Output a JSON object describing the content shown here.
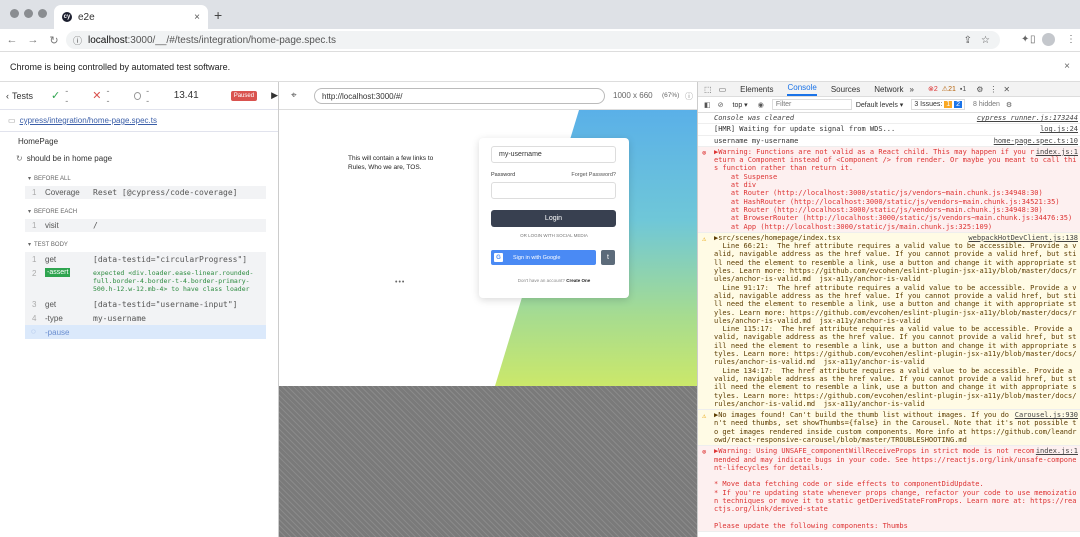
{
  "window": {
    "tab_title": "e2e",
    "tab_close": "×",
    "new_tab": "+",
    "url_host": "localhost",
    "url_rest": ":3000/__/#/tests/integration/home-page.spec.ts",
    "infobar_text": "Chrome is being controlled by automated test software.",
    "infobar_close": "×"
  },
  "reporter": {
    "tests_label": "Tests",
    "passed": "--",
    "failed": "--",
    "pending": "--",
    "duration": "13.41",
    "status_badge": "Paused",
    "spec_file": "cypress/integration/home-page.spec.ts",
    "suite": "HomePage",
    "test_title": "should be in home page",
    "before_all": "BEFORE ALL",
    "before_each": "BEFORE EACH",
    "test_body": "TEST BODY",
    "commands": [
      {
        "n": "1",
        "name": "Coverage",
        "msg": "Reset [@cypress/code-coverage]"
      },
      {
        "n": "1",
        "name": "visit",
        "msg": "/"
      },
      {
        "n": "1",
        "name": "get",
        "msg": "[data-testid=\"circularProgress\"]"
      },
      {
        "n": "2",
        "name": "-assert",
        "msg": "expected <div.loader.ease-linear.rounded-full.border-4.border-t-4.border-primary-500.h-12.w-12.mb-4> to have class loader"
      },
      {
        "n": "3",
        "name": "get",
        "msg": "[data-testid=\"username-input\"]"
      },
      {
        "n": "4",
        "name": "-type",
        "msg": "my-username"
      },
      {
        "n": "",
        "name": "-pause",
        "msg": ""
      }
    ]
  },
  "aut": {
    "url": "http://localhost:3000/#/",
    "size": "1000 x 660",
    "zoom": "(67%)",
    "tagline": "This will contain a few links to Rules, Who we are, TOS.",
    "username_value": "my-username",
    "password_label": "Password",
    "forgot_password": "Forget Password?",
    "login_button": "Login",
    "social_text": "OR LOGIN WITH SOCIAL MEDIA",
    "google_button": "Sign in with Google",
    "no_account": "Don't have an account?",
    "create_one": "Create One"
  },
  "devtools": {
    "tabs": [
      "Elements",
      "Console",
      "Sources",
      "Network",
      "»"
    ],
    "errors": "2",
    "warnings": "21",
    "infos": "1",
    "context": "top",
    "filter_placeholder": "Filter",
    "levels": "Default levels",
    "issues": "3 Issues:",
    "issues_warn": "1",
    "issues_info": "2",
    "hidden": "8 hidden",
    "logs": [
      {
        "kind": "ital",
        "text": "Console was cleared",
        "src": "cypress_runner.js:173244"
      },
      {
        "kind": "plain",
        "text": "[HMR] Waiting for update signal from WDS...",
        "src": "log.js:24"
      },
      {
        "kind": "plain",
        "text": "username my-username",
        "src": "home-page.spec.ts:10"
      },
      {
        "kind": "err",
        "text": "▶Warning: Functions are not valid as a React child. This may happen if you return a Component instead of <Component /> from render. Or maybe you meant to call this function rather than return it.\n    at Suspense\n    at div\n    at Router (http://localhost:3000/static/js/vendors~main.chunk.js:34948:30)\n    at HashRouter (http://localhost:3000/static/js/vendors~main.chunk.js:34521:35)\n    at Router (http://localhost:3000/static/js/vendors~main.chunk.js:34948:30)\n    at BrowserRouter (http://localhost:3000/static/js/vendors~main.chunk.js:34476:35)\n    at App (http://localhost:3000/static/js/main.chunk.js:325:109)",
        "src": "index.js:1"
      },
      {
        "kind": "warn",
        "text": "▶src/scenes/homepage/index.tsx\n  Line 66:21:  The href attribute requires a valid value to be accessible. Provide a valid, navigable address as the href value. If you cannot provide a valid href, but still need the element to resemble a link, use a button and change it with appropriate styles. Learn more: https://github.com/evcohen/eslint-plugin-jsx-a11y/blob/master/docs/rules/anchor-is-valid.md  jsx-a11y/anchor-is-valid\n  Line 91:17:  The href attribute requires a valid value to be accessible. Provide a valid, navigable address as the href value. If you cannot provide a valid href, but still need the element to resemble a link, use a button and change it with appropriate styles. Learn more: https://github.com/evcohen/eslint-plugin-jsx-a11y/blob/master/docs/rules/anchor-is-valid.md  jsx-a11y/anchor-is-valid\n  Line 115:17:  The href attribute requires a valid value to be accessible. Provide a valid, navigable address as the href value. If you cannot provide a valid href, but still need the element to resemble a link, use a button and change it with appropriate styles. Learn more: https://github.com/evcohen/eslint-plugin-jsx-a11y/blob/master/docs/rules/anchor-is-valid.md  jsx-a11y/anchor-is-valid\n  Line 134:17:  The href attribute requires a valid value to be accessible. Provide a valid, navigable address as the href value. If you cannot provide a valid href, but still need the element to resemble a link, use a button and change it with appropriate styles. Learn more: https://github.com/evcohen/eslint-plugin-jsx-a11y/blob/master/docs/rules/anchor-is-valid.md  jsx-a11y/anchor-is-valid",
        "src": "webpackHotDevClient.js:138"
      },
      {
        "kind": "warn",
        "text": "▶No images found! Can't build the thumb list without images. If you don't need thumbs, set showThumbs={false} in the Carousel. Note that it's not possible to get images rendered inside custom components. More info at https://github.com/leandrowd/react-responsive-carousel/blob/master/TROUBLESHOOTING.md",
        "src": "Carousel.js:930"
      },
      {
        "kind": "err",
        "text": "▶Warning: Using UNSAFE_componentWillReceiveProps in strict mode is not recommended and may indicate bugs in your code. See https://reactjs.org/link/unsafe-component-lifecycles for details.\n\n* Move data fetching code or side effects to componentDidUpdate.\n* If you're updating state whenever props change, refactor your code to use memoization techniques or move it to static getDerivedStateFromProps. Learn more at: https://reactjs.org/link/derived-state\n\nPlease update the following components: Thumbs",
        "src": "index.js:1"
      }
    ]
  },
  "colors": {
    "paused_badge": "#d9534f",
    "spec_link": "#3a5ea8",
    "login_button": "#384050",
    "google_button": "#4a8af4"
  }
}
